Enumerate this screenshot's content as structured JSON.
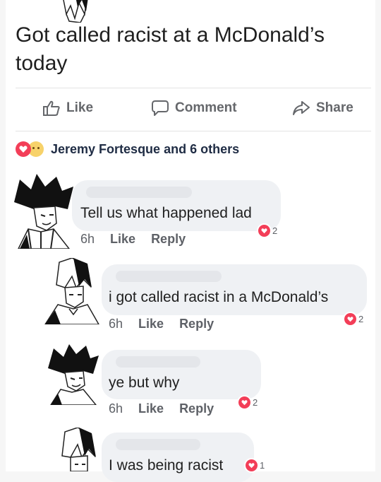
{
  "post": {
    "text": "Got called racist at a McDonald’s today",
    "actions": {
      "like": "Like",
      "comment": "Comment",
      "share": "Share"
    },
    "reactions": {
      "names": "Jeremy Fortesque and 6 others",
      "icons": [
        "heart-icon",
        "sad-face-icon"
      ]
    }
  },
  "comments": [
    {
      "text": "Tell us what happened lad",
      "time": "6h",
      "like": "Like",
      "reply": "Reply",
      "reaction_count": "2",
      "avatar": "dark-haired-manga-character"
    },
    {
      "text": "i got called racist in a McDonald’s",
      "time": "6h",
      "like": "Like",
      "reply": "Reply",
      "reaction_count": "2",
      "avatar": "two-tone-haired-manga-character"
    },
    {
      "text": "ye but why",
      "time": "6h",
      "like": "Like",
      "reply": "Reply",
      "reaction_count": "2",
      "avatar": "dark-haired-manga-character"
    },
    {
      "text": "I was being racist",
      "time": "",
      "like": "",
      "reply": "",
      "reaction_count": "1",
      "avatar": "two-tone-haired-manga-character"
    }
  ],
  "colors": {
    "heart": "#f33e58",
    "bubble": "#eff1f4",
    "meta": "#5e6167"
  }
}
